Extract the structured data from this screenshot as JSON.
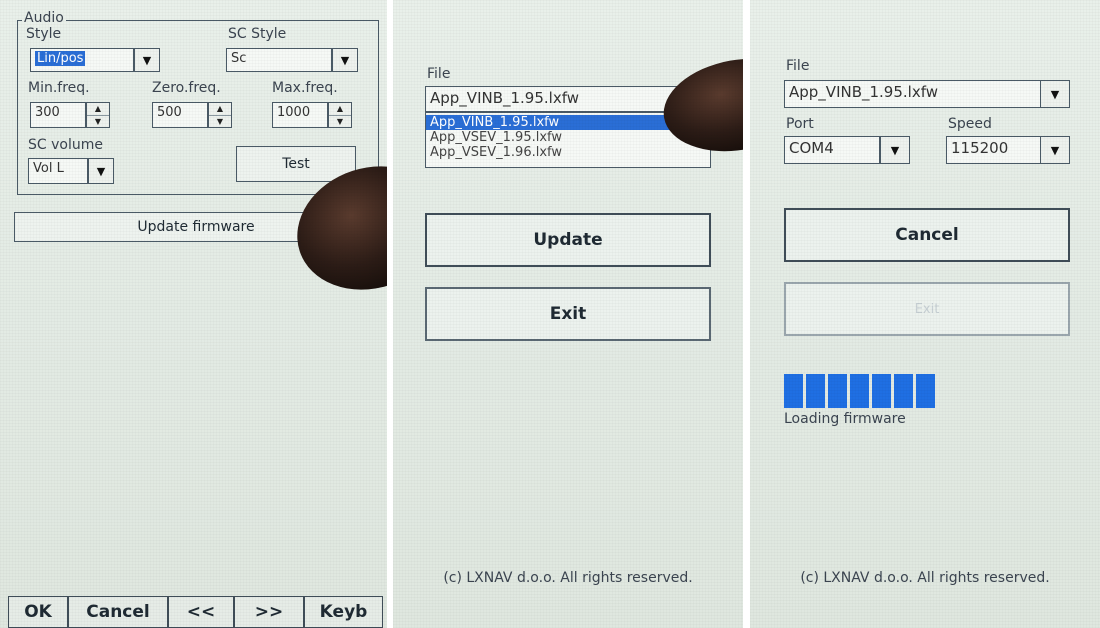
{
  "panel1": {
    "group_title": "Audio",
    "style_label": "Style",
    "style_value": "Lin/pos",
    "sc_style_label": "SC Style",
    "sc_style_value": "Sc",
    "min_freq_label": "Min.freq.",
    "min_freq_value": "300",
    "zero_freq_label": "Zero.freq.",
    "zero_freq_value": "500",
    "max_freq_label": "Max.freq.",
    "max_freq_value": "1000",
    "sc_volume_label": "SC volume",
    "sc_volume_value": "Vol L",
    "test_button": "Test",
    "update_firmware_button": "Update firmware",
    "bottom": {
      "ok": "OK",
      "cancel": "Cancel",
      "prev": "<<",
      "next": ">>",
      "keyb": "Keyb"
    }
  },
  "panel2": {
    "file_label": "File",
    "file_value": "App_VINB_1.95.lxfw",
    "file_options": [
      "App_VINB_1.95.lxfw",
      "App_VSEV_1.95.lxfw",
      "App_VSEV_1.96.lxfw"
    ],
    "selected_option": "App_VINB_1.95.lxfw",
    "update_button": "Update",
    "exit_button": "Exit",
    "copyright": "(c) LXNAV d.o.o. All rights reserved."
  },
  "panel3": {
    "file_label": "File",
    "file_value": "App_VINB_1.95.lxfw",
    "port_label": "Port",
    "port_value": "COM4",
    "speed_label": "Speed",
    "speed_value": "115200",
    "cancel_button": "Cancel",
    "exit_button": "Exit",
    "progress_blocks": 7,
    "status_text": "Loading firmware",
    "copyright": "(c) LXNAV d.o.o. All rights reserved."
  },
  "colors": {
    "accent": "#1f6fe3",
    "selection": "#2a6ed6"
  },
  "icons": {
    "dropdown": "chevron-down-icon",
    "spinner": "spinner-arrows-icon"
  }
}
